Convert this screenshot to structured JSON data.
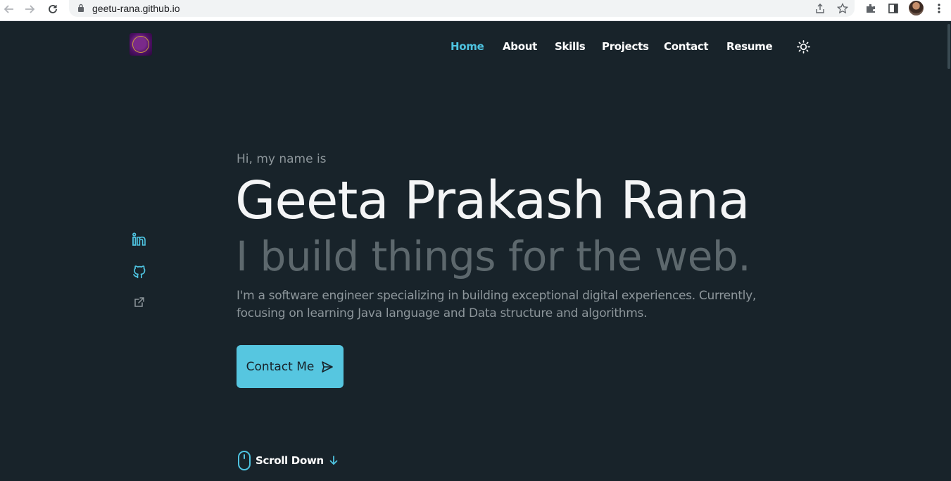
{
  "browser": {
    "url": "geetu-rana.github.io"
  },
  "nav": {
    "items": [
      {
        "label": "Home",
        "active": true
      },
      {
        "label": "About",
        "active": false
      },
      {
        "label": "Skills",
        "active": false
      },
      {
        "label": "Projects",
        "active": false
      },
      {
        "label": "Contact",
        "active": false
      },
      {
        "label": "Resume",
        "active": false
      }
    ]
  },
  "hero": {
    "intro": "Hi, my name is",
    "name": "Geeta Prakash Rana",
    "tagline": "I build things for the web.",
    "description": "I'm a software engineer specializing in building exceptional digital experiences. Currently, focusing on learning Java language and Data structure and algorithms.",
    "cta_label": "Contact Me",
    "scroll_label": "Scroll Down"
  },
  "social": [
    "linkedin-icon",
    "github-icon",
    "external-link-icon"
  ],
  "colors": {
    "background": "#18232a",
    "accent": "#56c6e0",
    "active_link": "#4ec3e0",
    "heading": "#f4f5f6",
    "muted": "#8d969b",
    "tagline": "#5d686d"
  }
}
